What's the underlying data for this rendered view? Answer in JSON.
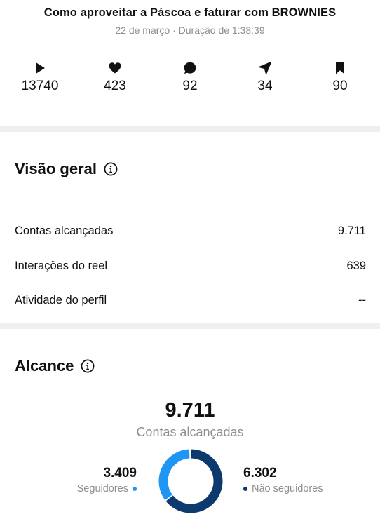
{
  "header": {
    "title": "Como aproveitar a Páscoa e faturar com BROWNIES",
    "meta": "22 de março · Duração de 1:38:39"
  },
  "stats": [
    {
      "icon": "play-icon",
      "value": "13740"
    },
    {
      "icon": "heart-icon",
      "value": "423"
    },
    {
      "icon": "comment-icon",
      "value": "92"
    },
    {
      "icon": "share-icon",
      "value": "34"
    },
    {
      "icon": "bookmark-icon",
      "value": "90"
    }
  ],
  "overview": {
    "title": "Visão geral",
    "info_icon": "info-icon",
    "rows": [
      {
        "label": "Contas alcançadas",
        "value": "9.711"
      },
      {
        "label": "Interações do reel",
        "value": "639"
      },
      {
        "label": "Atividade do perfil",
        "value": "--"
      }
    ]
  },
  "reach": {
    "title": "Alcance",
    "info_icon": "info-icon",
    "total": "9.711",
    "total_label": "Contas alcançadas",
    "followers": {
      "value": "3.409",
      "label": "Seguidores",
      "color": "#1f96f3",
      "fraction": 0.351
    },
    "non_followers": {
      "value": "6.302",
      "label": "Não seguidores",
      "color": "#0d3a6e",
      "fraction": 0.649
    }
  }
}
